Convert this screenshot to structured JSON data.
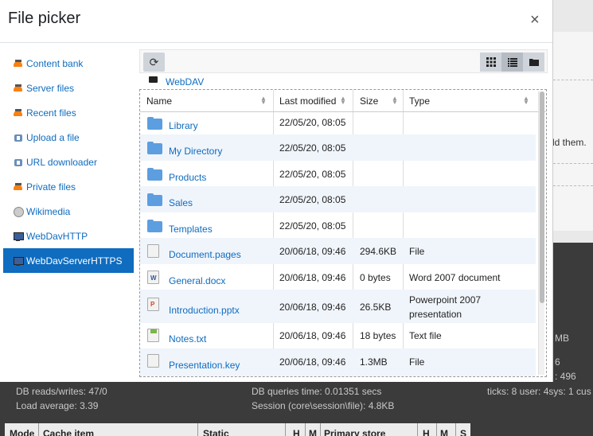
{
  "modal": {
    "title": "File picker",
    "close_label": "×"
  },
  "sidebar": {
    "items": [
      {
        "label": "Content bank",
        "icon": "moodle-icon"
      },
      {
        "label": "Server files",
        "icon": "moodle-icon"
      },
      {
        "label": "Recent files",
        "icon": "moodle-icon"
      },
      {
        "label": "Upload a file",
        "icon": "upload-icon"
      },
      {
        "label": "URL downloader",
        "icon": "upload-icon"
      },
      {
        "label": "Private files",
        "icon": "moodle-icon"
      },
      {
        "label": "Wikimedia",
        "icon": "globe-icon"
      },
      {
        "label": "WebDavHTTP",
        "icon": "monitor-icon"
      },
      {
        "label": "WebDavServerHTTPS",
        "icon": "monitor-icon",
        "active": true
      }
    ]
  },
  "toolbar": {
    "refresh_icon": "⟳",
    "views": [
      "icons-view",
      "list-view",
      "tree-view"
    ]
  },
  "breadcrumb": {
    "label": "WebDAV"
  },
  "table": {
    "headers": {
      "name": "Name",
      "modified": "Last modified",
      "size": "Size",
      "type": "Type"
    },
    "rows": [
      {
        "name": "Library",
        "modified": "22/05/20, 08:05",
        "size": "",
        "type": "",
        "kind": "folder"
      },
      {
        "name": "My Directory",
        "modified": "22/05/20, 08:05",
        "size": "",
        "type": "",
        "kind": "folder"
      },
      {
        "name": "Products",
        "modified": "22/05/20, 08:05",
        "size": "",
        "type": "",
        "kind": "folder"
      },
      {
        "name": "Sales",
        "modified": "22/05/20, 08:05",
        "size": "",
        "type": "",
        "kind": "folder"
      },
      {
        "name": "Templates",
        "modified": "22/05/20, 08:05",
        "size": "",
        "type": "",
        "kind": "folder"
      },
      {
        "name": "Document.pages",
        "modified": "20/06/18, 09:46",
        "size": "294.6KB",
        "type": "File",
        "kind": "file"
      },
      {
        "name": "General.docx",
        "modified": "20/06/18, 09:46",
        "size": "0 bytes",
        "type": "Word 2007 document",
        "kind": "word"
      },
      {
        "name": "Introduction.pptx",
        "modified": "20/06/18, 09:46",
        "size": "26.5KB",
        "type_line1": "Powerpoint 2007",
        "type_line2": "presentation",
        "kind": "ppt"
      },
      {
        "name": "Notes.txt",
        "modified": "20/06/18, 09:46",
        "size": "18 bytes",
        "type": "Text file",
        "kind": "txt"
      },
      {
        "name": "Presentation.key",
        "modified": "20/06/18, 09:46",
        "size": "1.3MB",
        "type": "File",
        "kind": "file"
      }
    ]
  },
  "background": {
    "right_text": "dd them.",
    "footer": {
      "db_reads": "DB reads/writes: 47/0",
      "load_avg": "Load average: 3.39",
      "db_queries": "DB queries time: 0.01351 secs",
      "session": "Session (core\\session\\file): 4.8KB",
      "ticks": "ticks: 8 user: 4sys: 1 cus",
      "side_mb": "MB",
      "side_6": "6",
      "side_496": ": 496"
    },
    "cache_table_headers": [
      "Mode",
      "Cache item",
      "Static",
      "H",
      "M",
      "Primary store",
      "H",
      "M",
      "S"
    ]
  }
}
